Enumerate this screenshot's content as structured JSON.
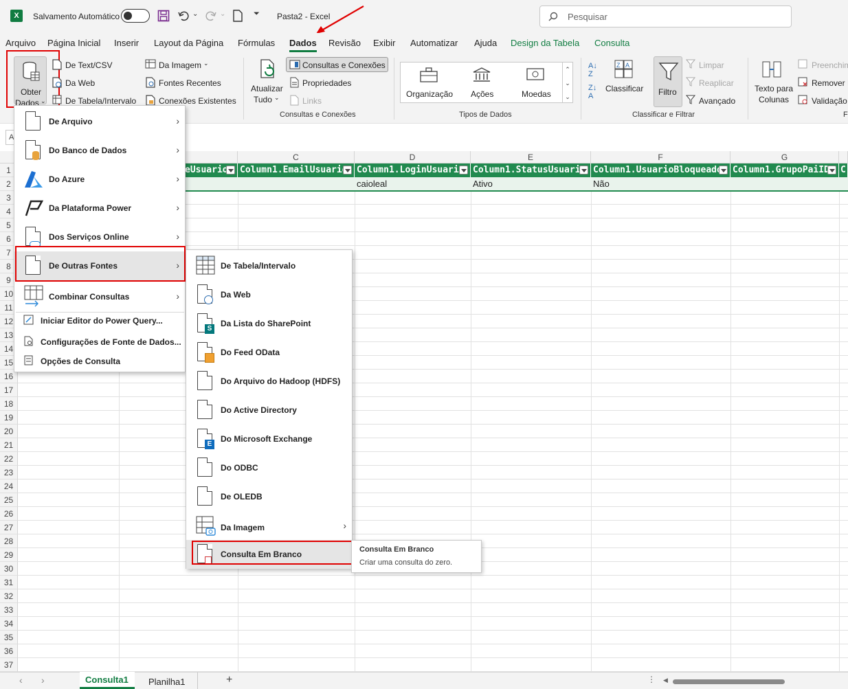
{
  "titlebar": {
    "autosave_label": "Salvamento Automático",
    "doc_title": "Pasta2  -  Excel",
    "search_placeholder": "Pesquisar"
  },
  "tabs": [
    "Arquivo",
    "Página Inicial",
    "Inserir",
    "Layout da Página",
    "Fórmulas",
    "Dados",
    "Revisão",
    "Exibir",
    "Automatizar",
    "Ajuda",
    "Design da Tabela",
    "Consulta"
  ],
  "active_tab": "Dados",
  "ribbon": {
    "get_data_label_1": "Obter",
    "get_data_label_2": "Dados",
    "text_csv": "De Text/CSV",
    "from_web": "Da Web",
    "from_table": "De Tabela/Intervalo",
    "from_image": "Da Imagem",
    "recent_sources": "Fontes Recentes",
    "existing_connections": "Conexões Existentes",
    "refresh_all_1": "Atualizar",
    "refresh_all_2": "Tudo",
    "queries_connections": "Consultas e Conexões",
    "properties": "Propriedades",
    "links": "Links",
    "group_queries": "Consultas e Conexões",
    "dt_org": "Organização",
    "dt_stocks": "Ações",
    "dt_currencies": "Moedas",
    "group_datatypes": "Tipos de Dados",
    "sort": "Classificar",
    "filter": "Filtro",
    "clear": "Limpar",
    "reapply": "Reaplicar",
    "advanced": "Avançado",
    "group_sort": "Classificar e Filtrar",
    "text_to_columns_1": "Texto para",
    "text_to_columns_2": "Colunas",
    "flash_fill": "Preenchim",
    "remove_dup": "Remover D",
    "validation": "Validação",
    "group_tools": "F"
  },
  "grid": {
    "col_letters": [
      "C",
      "D",
      "E",
      "F",
      "G"
    ],
    "row_numbers": [
      "1",
      "2",
      "3",
      "4",
      "5",
      "6",
      "7",
      "8",
      "9",
      "10",
      "11",
      "12",
      "13",
      "14",
      "15",
      "16",
      "17",
      "18",
      "19",
      "20",
      "21",
      "22",
      "23",
      "24",
      "25",
      "26",
      "27",
      "28",
      "29",
      "30",
      "31",
      "32",
      "33",
      "34",
      "35",
      "36",
      "37"
    ],
    "headers": [
      "eUsuario",
      "Column1.EmailUsuario",
      "Column1.LoginUsuario",
      "Column1.StatusUsuario",
      "Column1.UsuarioBloqueado",
      "Column1.GrupoPaiID",
      "C"
    ],
    "row2": [
      "",
      "",
      "caioleal",
      "Ativo",
      "Não",
      "",
      ""
    ]
  },
  "get_data_menu": {
    "items": [
      {
        "label": "De Arquivo"
      },
      {
        "label": "Do Banco de Dados"
      },
      {
        "label": "Do Azure"
      },
      {
        "label": "Da Plataforma Power"
      },
      {
        "label": "Dos Serviços Online"
      },
      {
        "label": "De Outras Fontes"
      },
      {
        "label": "Combinar Consultas"
      }
    ],
    "footer": [
      "Iniciar Editor do Power Query...",
      "Configurações de Fonte de Dados...",
      "Opções de Consulta"
    ]
  },
  "other_sources_menu": {
    "items": [
      {
        "label": "De Tabela/Intervalo"
      },
      {
        "label": "Da Web"
      },
      {
        "label": "Da Lista do SharePoint"
      },
      {
        "label": "Do Feed OData"
      },
      {
        "label": "Do Arquivo do Hadoop (HDFS)"
      },
      {
        "label": "Do Active Directory"
      },
      {
        "label": "Do Microsoft Exchange"
      },
      {
        "label": "Do ODBC"
      },
      {
        "label": "De OLEDB"
      },
      {
        "label": "Da Imagem"
      },
      {
        "label": "Consulta Em Branco"
      }
    ]
  },
  "tooltip": {
    "title": "Consulta Em Branco",
    "description": "Criar uma consulta do zero."
  },
  "sheets": {
    "tabs": [
      "Consulta1",
      "Planilha1"
    ],
    "active": "Consulta1"
  },
  "colors": {
    "excel_green": "#107c41",
    "table_header": "#218a4f",
    "highlight_red": "#e00000"
  }
}
